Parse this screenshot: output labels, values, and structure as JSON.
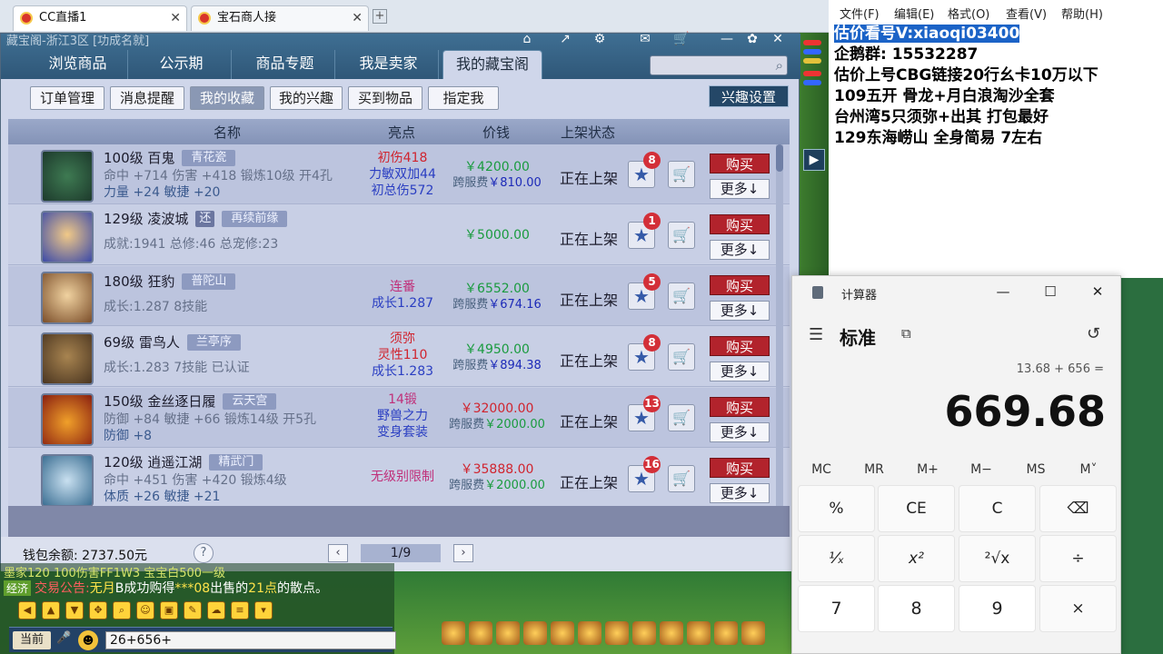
{
  "browser": {
    "tabs": [
      {
        "label": "CC直播1"
      },
      {
        "label": "宝石商人接"
      }
    ]
  },
  "panel": {
    "title": "藏宝阁-浙江3区 [功成名就]",
    "main_tabs": [
      "浏览商品",
      "公示期",
      "商品专题",
      "我是卖家",
      "我的藏宝阁"
    ],
    "sub_tabs": [
      "订单管理",
      "消息提醒",
      "我的收藏",
      "我的兴趣",
      "买到物品",
      "指定我"
    ],
    "interest_btn": "兴趣设置",
    "headers": {
      "name": "名称",
      "highlight": "亮点",
      "price": "价钱",
      "status": "上架状态"
    },
    "rows": [
      {
        "level_name": "100级  百鬼",
        "tag": "青花瓷",
        "desc1": "命中 +714 伤害 +418 锻炼10级 开4孔",
        "desc2": "力量 +24 敏捷 +20",
        "hl": [
          {
            "t": "初伤418",
            "c": "r"
          },
          {
            "t": "力敏双加44",
            "c": "b"
          },
          {
            "t": "初总伤572",
            "c": "b"
          }
        ],
        "price": "￥4200.00",
        "fee_label": "跨服费",
        "fee": "￥810.00",
        "status": "正在上架",
        "count": "8",
        "buy": "购买",
        "more": "更多↓"
      },
      {
        "level_name": "129级  凌波城",
        "tag_small": "还",
        "tag": "再续前缘",
        "desc1": "成就:1941 总修:46 总宠修:23",
        "desc2": "",
        "hl": [],
        "price": "￥5000.00",
        "fee_label": "",
        "fee": "",
        "status": "正在上架",
        "count": "1",
        "buy": "购买",
        "more": "更多↓"
      },
      {
        "level_name": "180级  狂豹",
        "tag": "普陀山",
        "desc1": "成长:1.287 8技能",
        "desc2": "",
        "hl": [
          {
            "t": "连番",
            "c": "p"
          },
          {
            "t": "成长1.287",
            "c": "b"
          }
        ],
        "price": "￥6552.00",
        "fee_label": "跨服费",
        "fee": "￥674.16",
        "status": "正在上架",
        "count": "5",
        "buy": "购买",
        "more": "更多↓"
      },
      {
        "level_name": "69级  雷鸟人",
        "tag": "兰亭序",
        "desc1": "成长:1.283 7技能 已认证",
        "desc2": "",
        "hl": [
          {
            "t": "须弥",
            "c": "r"
          },
          {
            "t": "灵性110",
            "c": "r"
          },
          {
            "t": "成长1.283",
            "c": "b"
          }
        ],
        "price": "￥4950.00",
        "fee_label": "跨服费",
        "fee": "￥894.38",
        "status": "正在上架",
        "count": "8",
        "buy": "购买",
        "more": "更多↓"
      },
      {
        "level_name": "150级  金丝逐日履",
        "tag": "云天宫",
        "desc1": "防御 +84 敏捷 +66 锻炼14级 开5孔",
        "desc2": "防御 +8",
        "hl": [
          {
            "t": "14锻",
            "c": "p"
          },
          {
            "t": "野兽之力",
            "c": "b"
          },
          {
            "t": "变身套装",
            "c": "b"
          }
        ],
        "price": "￥32000.00",
        "fee_label": "跨服费",
        "fee": "￥2000.00",
        "status": "正在上架",
        "count": "13",
        "buy": "购买",
        "more": "更多↓"
      },
      {
        "level_name": "120级  逍遥江湖",
        "tag": "精武门",
        "desc1": "命中 +451 伤害 +420 锻炼4级",
        "desc2": "体质 +26 敏捷 +21",
        "hl": [
          {
            "t": "无级别限制",
            "c": "p"
          }
        ],
        "price": "￥35888.00",
        "fee_label": "跨服费",
        "fee": "￥2000.00",
        "status": "正在上架",
        "count": "16",
        "buy": "购买",
        "more": "更多↓"
      }
    ],
    "wallet": "钱包余额: 2737.50元",
    "page": "1/9"
  },
  "chat": {
    "line1": "墨家120  100伤害FF1W3  宝宝白500一级",
    "line2_tag": "经济",
    "line2_a": "交易公告:",
    "line2_b": "无月",
    "line2_c": "B成功购得",
    "line2_d": "***08",
    "line2_e": "出售的",
    "line2_f": "21点",
    "line2_g": "的散点。",
    "current": "当前",
    "input": "26+656+"
  },
  "notepad": {
    "menu": [
      "文件(F)",
      "编辑(E)",
      "格式(O)",
      "查看(V)",
      "帮助(H)"
    ],
    "lines": [
      "估价看号V:xiaoqi03400",
      "企鹅群: 15532287",
      "估价上号CBG链接20行幺卡10万以下",
      "109五开 骨龙+月白浪淘沙全套",
      "台州湾5只须弥+出其 打包最好",
      "129东海崂山 全身简易  7左右"
    ]
  },
  "calculator": {
    "title": "计算器",
    "mode": "标准",
    "expression": "13.68 + 656 =",
    "result": "669.68",
    "memory": [
      "MC",
      "MR",
      "M+",
      "M−",
      "MS",
      "M˅"
    ],
    "keys": [
      "%",
      "CE",
      "C",
      "⌫",
      "¹⁄ₓ",
      "x²",
      "²√x",
      "÷",
      "7",
      "8",
      "9",
      "×"
    ]
  }
}
